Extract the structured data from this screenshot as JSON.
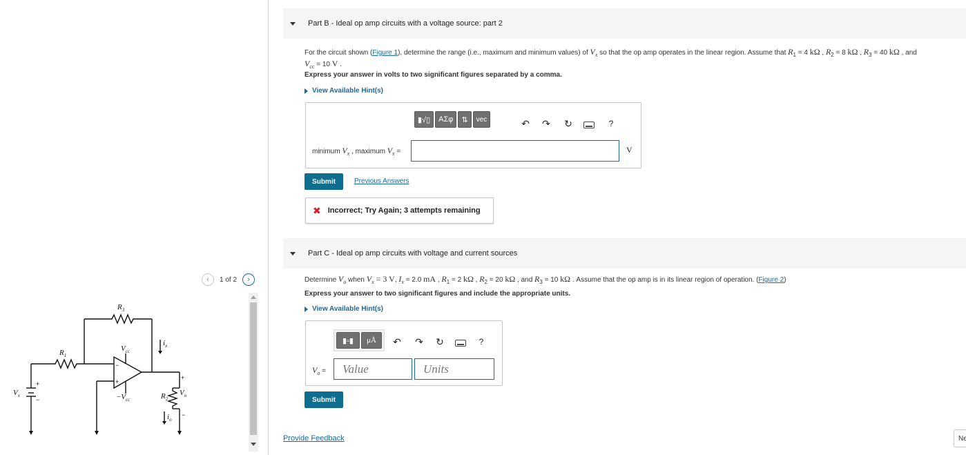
{
  "figure_panel": {
    "pager_label": "1 of 2",
    "circuit_labels": {
      "r1": "R",
      "r1_sub": "1",
      "r2": "R",
      "r2_sub": "2",
      "r3": "R",
      "r3_sub": "3",
      "vcc": "V",
      "vcc_sub": "cc",
      "neg_vcc": "−V",
      "neg_vcc_sub": "cc",
      "vx": "V",
      "vx_sub": "x",
      "ix": "i",
      "ix_sub": "x",
      "vo": "V",
      "vo_sub": "o",
      "io": "i",
      "io_sub": "o",
      "plus": "+",
      "minus": "−",
      "plus_in": "+",
      "minus_in": "−"
    }
  },
  "part_b": {
    "header": "Part B - Ideal op amp circuits with a voltage source: part 2",
    "q_1": "For the circuit shown (",
    "figure_link": "Figure 1",
    "q_2": "), determine the range (i.e., maximum and minimum values) of ",
    "q_vx": "V",
    "q_vx_sub": "x",
    "q_3": " so that the op amp operates in the linear region. Assume that ",
    "r1_sym": "R",
    "r1_sub": "1",
    "r1_val": " = 4 ",
    "r1_unit": "kΩ",
    "sep1": " , ",
    "r2_sym": "R",
    "r2_sub": "2",
    "r2_val": " = 8 ",
    "r2_unit": "kΩ",
    "sep2": " , ",
    "r3_sym": "R",
    "r3_sub": "3",
    "r3_val": " = 40 ",
    "r3_unit": "kΩ",
    "q_and": " , and",
    "vcc_sym": "V",
    "vcc_sub": "cc",
    "vcc_val": " = 10 ",
    "vcc_unit": "V",
    "q_end": " .",
    "instruction": "Express your answer in volts to two significant figures separated by a comma.",
    "hint": "View Available Hint(s)",
    "toolbar": {
      "template_btn": "▮√▯",
      "greek_btn": "ΑΣφ",
      "arrows_btn": "⇅",
      "vec_btn": "vec",
      "help": "?"
    },
    "answer_label_1": "minimum ",
    "answer_label_v1": "V",
    "answer_label_v1_sub": "x",
    "answer_label_2": " , maximum ",
    "answer_label_v2": "V",
    "answer_label_v2_sub": "x",
    "answer_label_3": " =",
    "answer_value": "",
    "unit": "V",
    "submit_label": "Submit",
    "previous_answers": "Previous Answers",
    "feedback": "Incorrect; Try Again; 3 attempts remaining"
  },
  "part_c": {
    "header": "Part C - Ideal op amp circuits with voltage and current sources",
    "q_1": "Determine ",
    "q_vo": "V",
    "q_vo_sub": "o",
    "q_2": " when ",
    "q_vx": "V",
    "q_vx_sub": "x",
    "q_vx_val": " = 3 V",
    "q_3": ", ",
    "q_ix": "I",
    "q_ix_sub": "x",
    "q_ix_val": " = 2.0 ",
    "q_ix_unit": "mA",
    "q_4": " , ",
    "r1_sym": "R",
    "r1_sub": "1",
    "r1_val": " = 2 ",
    "r1_unit": "kΩ",
    "sep1": " , ",
    "r2_sym": "R",
    "r2_sub": "2",
    "r2_val": " = 20 ",
    "r2_unit": "kΩ",
    "q_and": " , and ",
    "r3_sym": "R",
    "r3_sub": "3",
    "r3_val": " = 10 ",
    "r3_unit": "kΩ",
    "q_5": " . Assume that the op amp is in its linear region of operation. (",
    "figure_link": "Figure 2",
    "q_6": ")",
    "instruction": "Express your answer to two significant figures and include the appropriate units.",
    "hint": "View Available Hint(s)",
    "toolbar": {
      "unit_btn": "μÅ",
      "help": "?"
    },
    "answer_label": "V",
    "answer_label_sub": "o",
    "answer_eq": " =",
    "value_placeholder": "Value",
    "units_placeholder": "Units",
    "submit_label": "Submit"
  },
  "footer": {
    "provide_feedback": "Provide Feedback",
    "next_partial": "Ne"
  }
}
